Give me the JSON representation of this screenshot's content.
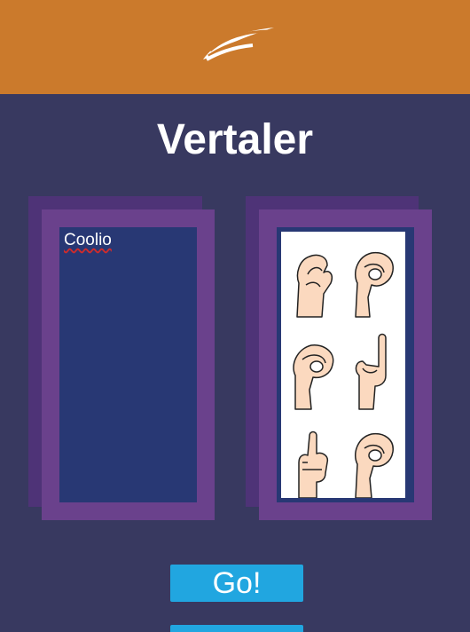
{
  "header": {
    "logo_icon": "wing-logo-icon",
    "background": "#cb7a2c"
  },
  "page": {
    "title": "Vertaler",
    "background": "#383960"
  },
  "input_panel": {
    "text": "Coolio"
  },
  "output_panel": {
    "image": "sign-language-hands-icon",
    "sign_count": 6
  },
  "actions": {
    "go_label": "Go!",
    "second_label": ""
  },
  "colors": {
    "panel_frame": "#6a418c",
    "panel_shadow": "#4e3377",
    "panel_inner": "#283874",
    "button": "#21a6e0"
  }
}
